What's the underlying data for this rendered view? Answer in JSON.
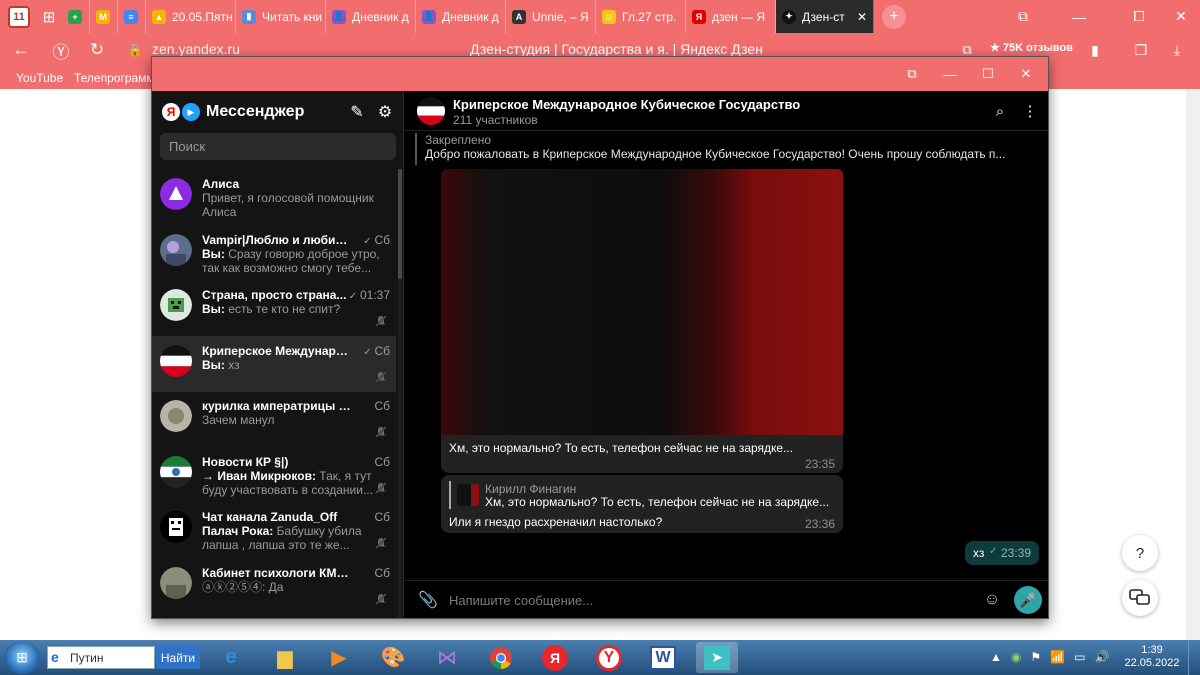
{
  "browser": {
    "tab_counter": "11",
    "tabs": [
      {
        "label": "",
        "color": "#2aa14b",
        "glyph": "+"
      },
      {
        "label": "",
        "color": "#f4b400",
        "glyph": "M"
      },
      {
        "label": "",
        "color": "#4285f4",
        "glyph": "≡"
      },
      {
        "label": "20.05.Пятн",
        "color": "#f4b400",
        "glyph": "▲"
      },
      {
        "label": "Читать кни",
        "color": "#5a8bd6",
        "glyph": "▮"
      },
      {
        "label": "Дневник д",
        "color": "#8a56c2",
        "glyph": "👤"
      },
      {
        "label": "Дневник д",
        "color": "#8a56c2",
        "glyph": "👤"
      },
      {
        "label": "Unnie, – Я",
        "color": "#333333",
        "glyph": "A"
      },
      {
        "label": "Гл.27 стр.",
        "color": "#f5c518",
        "glyph": "☺"
      },
      {
        "label": "дзен — Я",
        "color": "#e00000",
        "glyph": "Я"
      }
    ],
    "active_tab": {
      "label": "Дзен-ст"
    },
    "url": "zen.yandex.ru",
    "page_title": "Дзен-студия | Государства и я. | Яндекс Дзен",
    "reviews": "★ 75K отзывов",
    "bookmarks": [
      "YouTube",
      "Телепрограмма"
    ]
  },
  "messenger": {
    "logo_text": "Мессенджер",
    "search_placeholder": "Поиск",
    "chats": [
      {
        "name": "Алиса",
        "sender": "",
        "preview": "Привет, я голосовой помощник Алиса",
        "time": "",
        "muted": false,
        "read": false,
        "avatar": "alisa"
      },
      {
        "name": "Vampir|Люблю и любим...",
        "sender": "Вы:",
        "preview": "Сразу говорю доброе утро, так как возможно смогу тебе...",
        "time": "Сб",
        "muted": false,
        "read": true,
        "avatar": "vampir"
      },
      {
        "name": "Страна, просто страна...",
        "sender": "Вы:",
        "preview": "есть те кто не спит?",
        "time": "01:37",
        "muted": true,
        "read": true,
        "avatar": "strana"
      },
      {
        "name": "Криперское Международ...",
        "sender": "Вы:",
        "preview": "хз",
        "time": "Сб",
        "muted": true,
        "read": true,
        "avatar": "flag"
      },
      {
        "name": "курилка императрицы [av...",
        "sender": "",
        "preview": "Зачем манул",
        "time": "Сб",
        "muted": true,
        "read": false,
        "avatar": "kurilka"
      },
      {
        "name": "Новости КР §|)",
        "sender": "→ Иван Микрюков:",
        "preview": "Так, я тут буду участвовать в создании...",
        "time": "Сб",
        "muted": true,
        "read": false,
        "avatar": "novosti"
      },
      {
        "name": "Чат канала Zanuda_Off",
        "sender": "Палач Рока:",
        "preview": "Бабушку убила лапша , лапша это те же...",
        "time": "Сб",
        "muted": true,
        "read": false,
        "avatar": "zanuda"
      },
      {
        "name": "Кабинет психологи КМКГ(...",
        "sender": "",
        "preview": "ⓐⓚ②⑤④: Да",
        "time": "Сб",
        "muted": true,
        "read": false,
        "avatar": "kabinet"
      }
    ],
    "chat": {
      "title": "Криперское Международное Кубическое Государство",
      "subtitle": "211 участников",
      "pinned_label": "Закреплено",
      "pinned_text": "Добро пожаловать в Криперское Международное Кубическое Государство! Очень прошу соблюдать п...",
      "messages": {
        "image_caption": "Хм, это нормально? То есть, телефон сейчас не на зарядке...",
        "image_time": "23:35",
        "reply_author": "Кирилл Финагин",
        "reply_text": "Хм, это нормально? То есть, телефон сейчас не на зарядке...",
        "reply_body": "Или я гнездо расхреначил настолько?",
        "reply_time": "23:36",
        "out_text": "хз",
        "out_time": "23:39"
      },
      "input_placeholder": "Напишите сообщение..."
    }
  },
  "page": {
    "help": "?"
  },
  "taskbar": {
    "search_value": "Путин",
    "search_button": "Найти",
    "time": "1:39",
    "date": "22.05.2022"
  }
}
